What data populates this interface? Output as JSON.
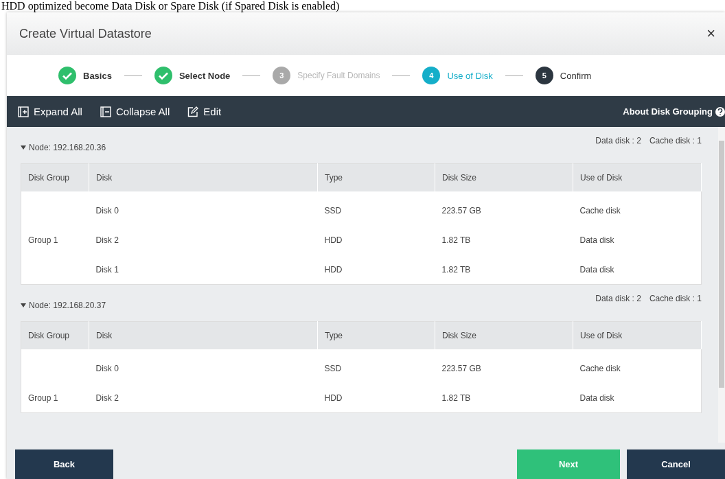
{
  "caption": "HDD optimized become Data Disk or Spare Disk (if Spared Disk is enabled)",
  "window": {
    "title": "Create Virtual Datastore",
    "close": "×"
  },
  "steps": [
    {
      "label": "Basics",
      "completed": true,
      "selected": false,
      "disabled": false
    },
    {
      "label": "Select Node",
      "completed": true,
      "selected": false,
      "disabled": false
    },
    {
      "number": "3",
      "label": "Specify Fault Domains",
      "completed": false,
      "selected": false,
      "disabled": true
    },
    {
      "number": "4",
      "label": "Use of Disk",
      "completed": false,
      "selected": true,
      "disabled": false
    },
    {
      "number": "5",
      "label": "Confirm",
      "completed": false,
      "selected": false,
      "disabled": false
    }
  ],
  "toolbar": {
    "items": [
      {
        "kind": "expand",
        "label": "Expand All"
      },
      {
        "kind": "collapse",
        "label": "Collapse All"
      },
      {
        "kind": "edit",
        "label": "Edit"
      }
    ],
    "help": "About Disk Grouping"
  },
  "nodes": [
    {
      "title": "Node: 192.168.20.36",
      "expanded": true,
      "counts": [
        "Data disk : 2",
        "Cache disk : 1"
      ],
      "columns": [
        "Disk Group",
        "Disk",
        "Type",
        "Disk Size",
        "Use of Disk"
      ],
      "rows": [
        [
          "",
          "Disk 0",
          "SSD",
          "223.57 GB",
          "Cache disk"
        ],
        [
          "Group 1",
          "Disk 2",
          "HDD",
          "1.82 TB",
          "Data disk"
        ],
        [
          "",
          "Disk 1",
          "HDD",
          "1.82 TB",
          "Data disk"
        ]
      ]
    },
    {
      "title": "Node: 192.168.20.37",
      "expanded": true,
      "counts": [
        "Data disk : 2",
        "Cache disk : 1"
      ],
      "columns": [
        "Disk Group",
        "Disk",
        "Type",
        "Disk Size",
        "Use of Disk"
      ],
      "rows": [
        [
          "",
          "Disk 0",
          "SSD",
          "223.57 GB",
          "Cache disk"
        ],
        [
          "Group 1",
          "Disk 2",
          "HDD",
          "1.82 TB",
          "Data disk"
        ]
      ]
    }
  ],
  "buttons": [
    {
      "kind": "back",
      "label": "Back"
    },
    {
      "kind": "next",
      "label": "Next"
    },
    {
      "kind": "cancel",
      "label": "Cancel"
    }
  ]
}
